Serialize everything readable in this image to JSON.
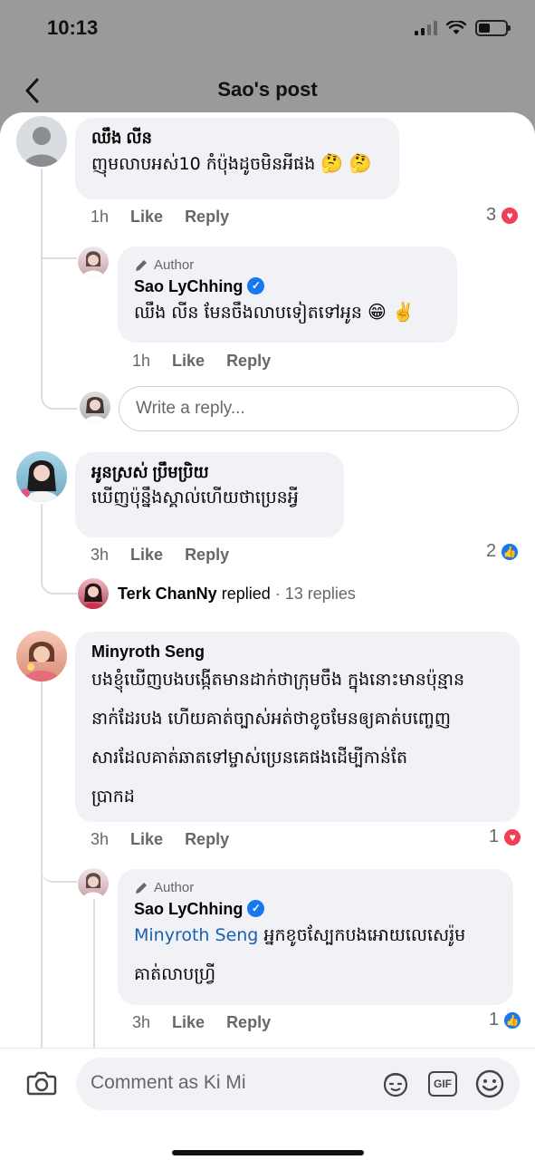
{
  "status_bar": {
    "time": "10:13"
  },
  "header": {
    "title": "Sao's post"
  },
  "comments": [
    {
      "name": "ឈឹង លីន",
      "text": "ញុមលាបអស់10 កំប៉ុងដូចមិនអីផង",
      "emojis": "🤔 🤔",
      "time": "1h",
      "like_label": "Like",
      "reply_label": "Reply",
      "reaction_count": "3",
      "reaction_type": "love"
    },
    {
      "author_tag": "Author",
      "name": "Sao LyChhing",
      "text": "ឈឹង លីន មែនចឹងលាបទៀតទៅអូន",
      "emojis": "😁 ✌️",
      "time": "1h",
      "like_label": "Like",
      "reply_label": "Reply"
    },
    {
      "name": "អូនស្រស់ ប្រឹមប្រិយ",
      "text": "ឃើញប៉ុន្នឹងស្គាល់ហើយថាប្រេនអ្វី",
      "time": "3h",
      "like_label": "Like",
      "reply_label": "Reply",
      "reaction_count": "2",
      "reaction_type": "like"
    },
    {
      "name": "Minyroth Seng",
      "text_lines": [
        "បងខ្ញុំឃើញបងបង្កើតមានដាក់ថាក្រុមចឹង ក្នុងនោះមានប៉ុន្មាន",
        "នាក់ដែរបង ហើយគាត់ច្បាស់អត់ថាខូចមែនឲ្យគាត់បញ្ចេញ",
        "សារដែលគាត់ឆាតទៅម្ចាស់ប្រេនគេផងដើម្បីកាន់តែ",
        "ប្រាកដ"
      ],
      "time": "3h",
      "like_label": "Like",
      "reply_label": "Reply",
      "reaction_count": "1",
      "reaction_type": "love"
    },
    {
      "author_tag": "Author",
      "name": "Sao LyChhing",
      "mention": "Minyroth Seng",
      "text_lines": [
        " អ្នកខូចស្បែកបងអោយលេសេរ៉ូម",
        "គាត់លាបហ្វ្រី"
      ],
      "time": "3h",
      "like_label": "Like",
      "reply_label": "Reply",
      "reaction_count": "1",
      "reaction_type": "like"
    }
  ],
  "reply_box": {
    "placeholder": "Write a reply..."
  },
  "replied_summary": {
    "name": "Terk ChanNy",
    "verb": "replied",
    "count": "· 13 replies"
  },
  "composer": {
    "placeholder": "Comment as Ki Mi",
    "gif_label": "GIF"
  },
  "colors": {
    "bubble": "#f0f2f5",
    "link": "#1a5fb4",
    "love": "#f33e58",
    "like": "#1877f2"
  }
}
